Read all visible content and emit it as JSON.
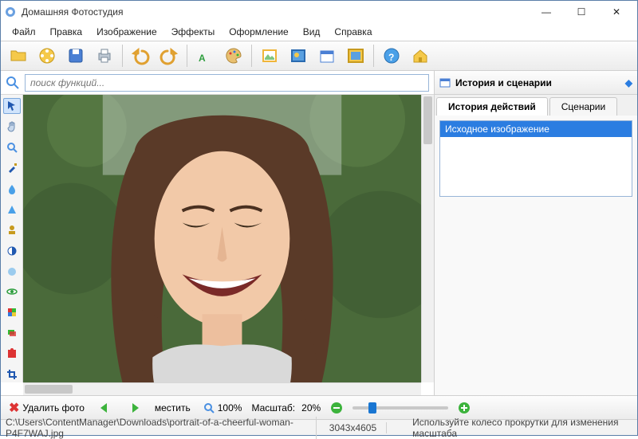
{
  "window": {
    "title": "Домашняя Фотостудия",
    "buttons": {
      "min": "—",
      "max": "☐",
      "close": "✕"
    }
  },
  "menu": [
    "Файл",
    "Правка",
    "Изображение",
    "Эффекты",
    "Оформление",
    "Вид",
    "Справка"
  ],
  "toolbar_icons": [
    "open-folder-icon",
    "film-icon",
    "save-icon",
    "print-icon",
    "_sep",
    "undo-icon",
    "redo-icon",
    "_sep",
    "text-icon",
    "palette-icon",
    "_sep",
    "picture-icon",
    "picture2-icon",
    "calendar-icon",
    "picture-frame-icon",
    "_sep",
    "help-icon",
    "home-icon"
  ],
  "search": {
    "placeholder": "поиск функций..."
  },
  "tools": [
    "pointer-icon",
    "hand-icon",
    "zoom-icon",
    "brush-icon",
    "drop-icon",
    "triangle-icon",
    "stamp-icon",
    "contrast-icon",
    "blur-icon",
    "eye-icon",
    "color-square-icon",
    "layers-icon",
    "puzzle-icon",
    "crop-icon"
  ],
  "history_panel": {
    "title": "История и сценарии",
    "tabs": [
      "История действий",
      "Сценарии"
    ],
    "active_tab": 0,
    "items": [
      "Исходное изображение"
    ]
  },
  "bottom": {
    "delete_label": "Удалить фото",
    "fit_label": "местить",
    "zoom100_label": "100%",
    "scale_label": "Масштаб:",
    "scale_value": "20%"
  },
  "status": {
    "path": "C:\\Users\\ContentManager\\Downloads\\portrait-of-a-cheerful-woman-P4F7WAJ.jpg",
    "dims": "3043x4605",
    "hint": "Используйте колесо прокрутки для изменения масштаба"
  },
  "colors": {
    "accent": "#2b7de1"
  }
}
